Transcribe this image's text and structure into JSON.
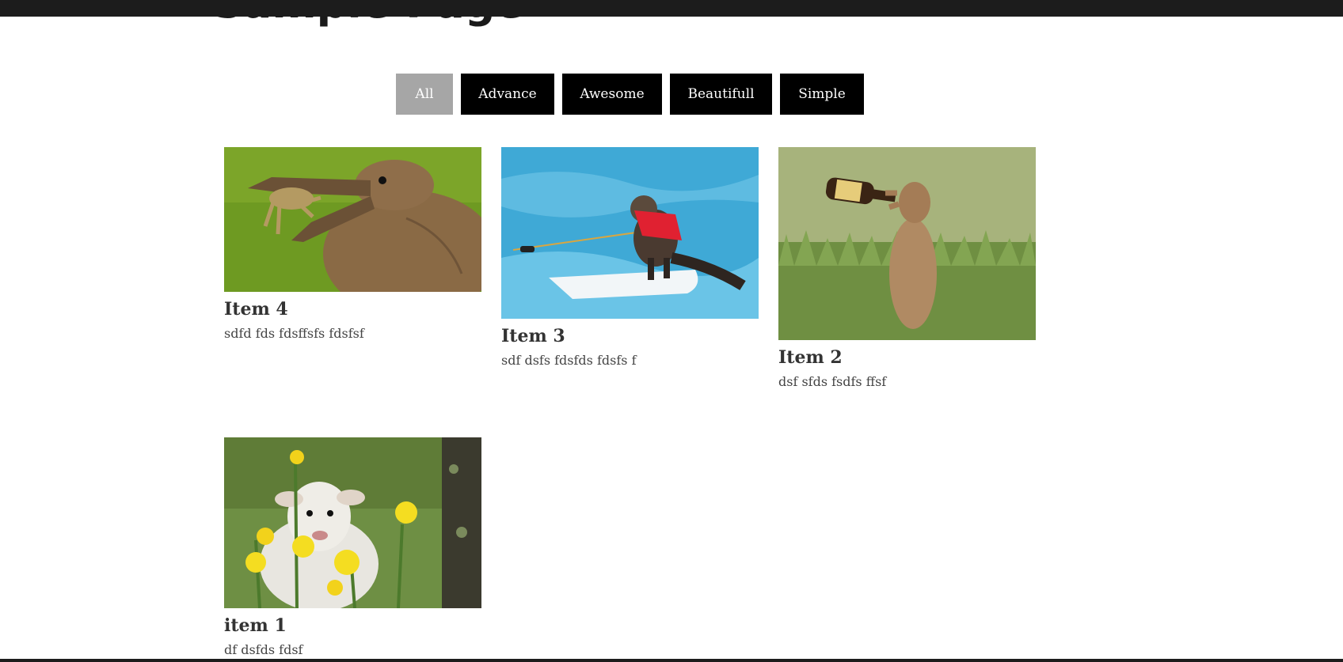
{
  "page": {
    "title": "Sample Page"
  },
  "filters": [
    {
      "label": "All",
      "active": true
    },
    {
      "label": "Advance",
      "active": false
    },
    {
      "label": "Awesome",
      "active": false
    },
    {
      "label": "Beautifull",
      "active": false
    },
    {
      "label": "Simple",
      "active": false
    }
  ],
  "items": [
    {
      "title": "Item 4",
      "description": "sdfd fds fdsffsfs fdsfsf",
      "image": "bird catching frog"
    },
    {
      "title": "Item 3",
      "description": "sdf dsfs fdsfds fdsfs f",
      "image": "squirrel water skiing"
    },
    {
      "title": "Item 2",
      "description": "dsf sfds fsdfs ffsf",
      "image": "prairie dog drinking from bottle"
    },
    {
      "title": "item 1",
      "description": "df dsfds fdsf",
      "image": "lamb among daffodils"
    }
  ],
  "colors": {
    "top_bar": "#1c1c1c",
    "filter_active": "#a6a6a6",
    "filter_inactive": "#000000",
    "filter_text": "#ffffff",
    "item_title": "#333333"
  }
}
